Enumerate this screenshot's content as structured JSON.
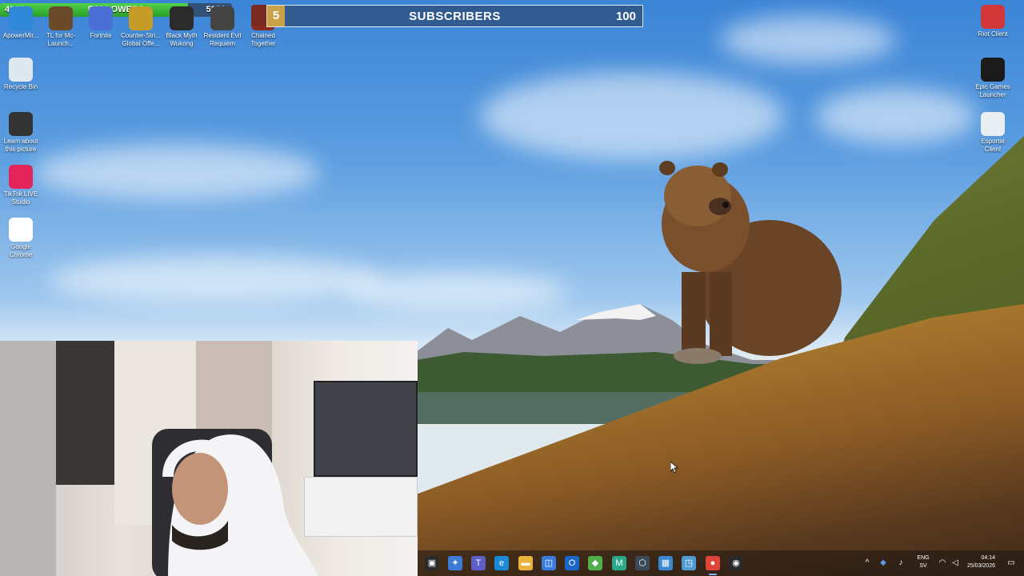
{
  "overlay": {
    "followers": {
      "label": "FOLLOWERS",
      "current": "4044",
      "goal": "5000",
      "progress": 0.8088
    },
    "subscribers": {
      "label": "SUBSCRIBERS",
      "current": "5",
      "goal": "100"
    }
  },
  "desktop_icons_top": [
    {
      "label": "ApowerMir...",
      "icon": "phone-mirror-icon",
      "color": "#2f88d8"
    },
    {
      "label": "TL for Mc-Launch...",
      "icon": "minecraft-launcher-icon",
      "color": "#6b4a2a"
    },
    {
      "label": "Fortnite",
      "icon": "fortnite-icon",
      "color": "#4b6fd6"
    },
    {
      "label": "Counter-Stri... Global Offe...",
      "icon": "csgo-icon",
      "color": "#c79b28"
    },
    {
      "label": "Black Myth Wukong",
      "icon": "black-myth-icon",
      "color": "#2b2b2b"
    },
    {
      "label": "Resident Evil Requiem",
      "icon": "resident-evil-icon",
      "color": "#444444"
    },
    {
      "label": "Chained Together",
      "icon": "chained-together-icon",
      "color": "#8a2a20"
    }
  ],
  "desktop_icons_left": [
    {
      "label": "Recycle Bin",
      "icon": "recycle-bin-icon",
      "color": "#dfe8ef"
    },
    {
      "label": "Learn about this picture",
      "icon": "learn-about-picture-icon",
      "color": "#333333"
    },
    {
      "label": "TikTok LIVE Studio",
      "icon": "tiktok-live-icon",
      "color": "#e3245a"
    },
    {
      "label": "Google Chrome",
      "icon": "chrome-icon",
      "color": "#ffffff"
    }
  ],
  "desktop_icons_right": [
    {
      "label": "Riot Client",
      "icon": "riot-client-icon",
      "color": "#d13639"
    },
    {
      "label": "Epic Games Launcher",
      "icon": "epic-games-icon",
      "color": "#1b1b1b"
    },
    {
      "label": "Esportal Client",
      "icon": "esportal-icon",
      "color": "#e9eef2"
    }
  ],
  "taskbar": {
    "apps": [
      {
        "name": "start-button",
        "glyph": "▣",
        "color": "#2a2a2a"
      },
      {
        "name": "copilot-icon",
        "glyph": "✦",
        "color": "#3b7bd6"
      },
      {
        "name": "teams-icon",
        "glyph": "T",
        "color": "#5b5fc7"
      },
      {
        "name": "edge-icon",
        "glyph": "e",
        "color": "#1b8ad6"
      },
      {
        "name": "file-explorer-icon",
        "glyph": "▬",
        "color": "#e8b53a"
      },
      {
        "name": "microsoft-store-icon",
        "glyph": "◫",
        "color": "#3a7be0"
      },
      {
        "name": "outlook-icon",
        "glyph": "O",
        "color": "#1a67c7"
      },
      {
        "name": "vpn-shield-icon",
        "glyph": "◆",
        "color": "#4fae4a"
      },
      {
        "name": "microsoft-365-icon",
        "glyph": "M",
        "color": "#2aa88a"
      },
      {
        "name": "settings-icon",
        "glyph": "⬡",
        "color": "#3b4a5a"
      },
      {
        "name": "photos-icon",
        "glyph": "▦",
        "color": "#3b86d0"
      },
      {
        "name": "snipping-tool-icon",
        "glyph": "◳",
        "color": "#4f9ad0"
      },
      {
        "name": "chrome-taskbar-icon",
        "glyph": "●",
        "color": "#e0453a"
      },
      {
        "name": "obs-icon",
        "glyph": "◉",
        "color": "#2a2a2a"
      }
    ],
    "tray": {
      "language_line1": "ENG",
      "language_line2": "SV",
      "time": "04:14",
      "date": "25/03/2026"
    }
  }
}
